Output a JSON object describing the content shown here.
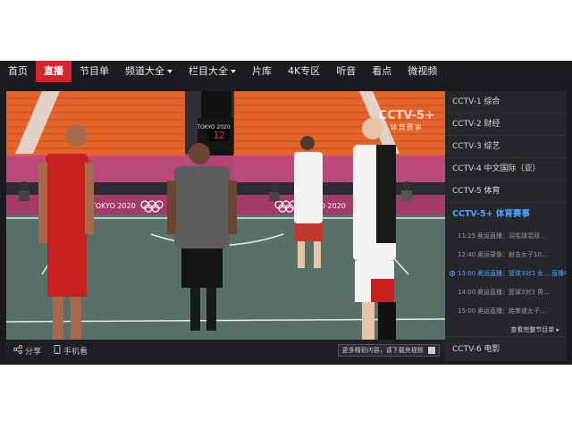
{
  "nav": {
    "items": [
      {
        "label": "首页",
        "caret": false
      },
      {
        "label": "直播",
        "caret": false,
        "active": true
      },
      {
        "label": "节目单",
        "caret": false
      },
      {
        "label": "频道大全",
        "caret": true
      },
      {
        "label": "栏目大全",
        "caret": true
      },
      {
        "label": "片库",
        "caret": false
      },
      {
        "label": "4K专区",
        "caret": false
      },
      {
        "label": "听音",
        "caret": false
      },
      {
        "label": "看点",
        "caret": false
      },
      {
        "label": "微视频",
        "caret": false
      }
    ]
  },
  "video": {
    "watermark_main": "CCTV-5+",
    "watermark_sub": "体育赛事",
    "banner_text": "TOKYO 2020",
    "shot_clock": "12",
    "colors": {
      "court": "#59706a",
      "seats": "#e8692a",
      "wall": "#a93c6a"
    }
  },
  "controls": {
    "share_label": "分享",
    "mobile_label": "手机看",
    "promo_text": "更多精彩内容，请下载央视频"
  },
  "sidebar": {
    "channels": [
      {
        "label": "CCTV-1 综合"
      },
      {
        "label": "CCTV-2 财经"
      },
      {
        "label": "CCTV-3 综艺"
      },
      {
        "label": "CCTV-4 中文国际（亚）"
      },
      {
        "label": "CCTV-5 体育"
      },
      {
        "label": "CCTV-5+ 体育赛事",
        "active": true
      }
    ],
    "schedule": [
      {
        "time": "11:25",
        "title": "奥运直播：羽毛球混双..."
      },
      {
        "time": "12:40",
        "title": "奥运录像：射击女子10..."
      },
      {
        "time": "13:00",
        "title": "奥运直播：篮球3对3 女... 直播中",
        "live": true
      },
      {
        "time": "14:00",
        "title": "奥运直播：篮球3对3 男..."
      },
      {
        "time": "15:00",
        "title": "奥运直播：跆拳道女子..."
      }
    ],
    "more_label": "查看完整节目单 ▸",
    "bottom_channel": "CCTV-6 电影"
  }
}
